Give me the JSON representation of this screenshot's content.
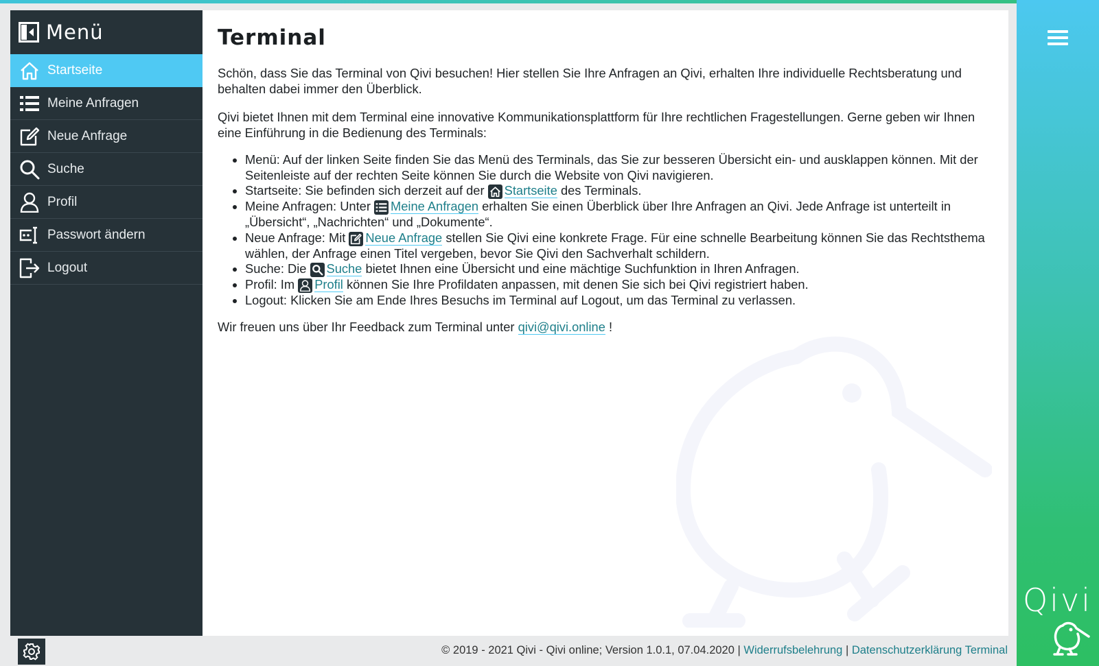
{
  "menu": {
    "title": "Menü",
    "items": [
      {
        "label": "Startseite",
        "icon": "home-icon",
        "active": true
      },
      {
        "label": "Meine Anfragen",
        "icon": "list-icon"
      },
      {
        "label": "Neue Anfrage",
        "icon": "edit-icon"
      },
      {
        "label": "Suche",
        "icon": "search-icon"
      },
      {
        "label": "Profil",
        "icon": "user-icon"
      },
      {
        "label": "Passwort ändern",
        "icon": "password-icon"
      },
      {
        "label": "Logout",
        "icon": "logout-icon"
      }
    ]
  },
  "page": {
    "title": "Terminal",
    "intro": "Schön, dass Sie das Terminal von Qivi besuchen! Hier stellen Sie Ihre Anfragen an Qivi, erhalten Ihre individuelle Rechtsberatung und behalten dabei immer den Überblick.",
    "intro2": "Qivi bietet Ihnen mit dem Terminal eine innovative Kommunikationsplattform für Ihre rechtlichen Fragestellungen. Gerne geben wir Ihnen eine Einführung in die Bedienung des Terminals:",
    "bullets": {
      "menu": "Menü: Auf der linken Seite finden Sie das Menü des Terminals, das Sie zur besseren Übersicht ein- und ausklappen können. Mit der Seitenleiste auf der rechten Seite können Sie durch die Website von Qivi navigieren.",
      "start_pre": "Startseite: Sie befinden sich derzeit auf der ",
      "start_link": "Startseite",
      "start_post": " des Terminals.",
      "anfragen_pre": "Meine Anfragen: Unter ",
      "anfragen_link": "Meine Anfragen",
      "anfragen_post": " erhalten Sie einen Überblick über Ihre Anfragen an Qivi. Jede Anfrage ist unterteilt in „Übersicht“, „Nachrichten“ und „Dokumente“.",
      "neu_pre": "Neue Anfrage: Mit ",
      "neu_link": "Neue Anfrage",
      "neu_post": " stellen Sie Qivi eine konkrete Frage. Für eine schnelle Bearbeitung können Sie das Rechtsthema wählen, der Anfrage einen Titel vergeben, bevor Sie Qivi den Sachverhalt schildern.",
      "suche_pre": "Suche: Die ",
      "suche_link": "Suche",
      "suche_post": " bietet Ihnen eine Übersicht und eine mächtige Suchfunktion in Ihren Anfragen.",
      "profil_pre": "Profil: Im ",
      "profil_link": "Profil",
      "profil_post": " können Sie Ihre Profildaten anpassen, mit denen Sie sich bei Qivi registriert haben.",
      "logout": "Logout: Klicken Sie am Ende Ihres Besuchs im Terminal auf Logout, um das Terminal zu verlassen."
    },
    "feedback_pre": "Wir freuen uns über Ihr Feedback zum Terminal unter ",
    "feedback_link": "qivi@qivi.online",
    "feedback_post": " !"
  },
  "footer": {
    "copyright": "© 2019 - 2021 Qivi - Qivi online; Version 1.0.1, 07.04.2020 | ",
    "link1": "Widerrufsbelehrung",
    "sep": " | ",
    "link2": "Datenschutzerklärung Terminal"
  },
  "brand": {
    "name": "Qivi"
  },
  "colors": {
    "accent": "#4fc9f3",
    "sidebar": "#263238",
    "link": "#1e7f8a"
  }
}
